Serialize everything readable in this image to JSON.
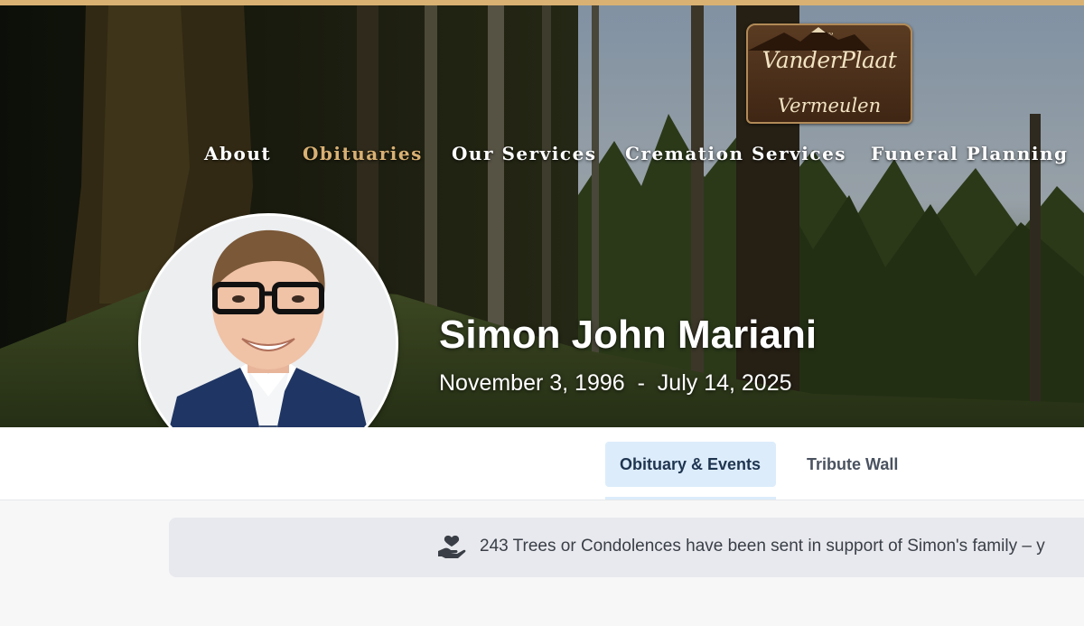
{
  "brand": {
    "logo_line1": "VanderPlaat",
    "logo_line2": "Vermeulen",
    "accent": "#d9b173"
  },
  "nav": {
    "items": [
      {
        "label": "About",
        "active": false
      },
      {
        "label": "Obituaries",
        "active": true
      },
      {
        "label": "Our Services",
        "active": false
      },
      {
        "label": "Cremation Services",
        "active": false
      },
      {
        "label": "Funeral Planning",
        "active": false
      }
    ]
  },
  "profile": {
    "name": "Simon John Mariani",
    "dates": "November 3, 1996  -  July 14, 2025"
  },
  "tabs": {
    "items": [
      {
        "label": "Obituary & Events",
        "active": true
      },
      {
        "label": "Tribute Wall",
        "active": false
      }
    ],
    "active_color": "#dcecfb"
  },
  "banner": {
    "icon": "hand-heart-icon",
    "text": "243 Trees or Condolences have been sent in support of Simon's family – y"
  }
}
